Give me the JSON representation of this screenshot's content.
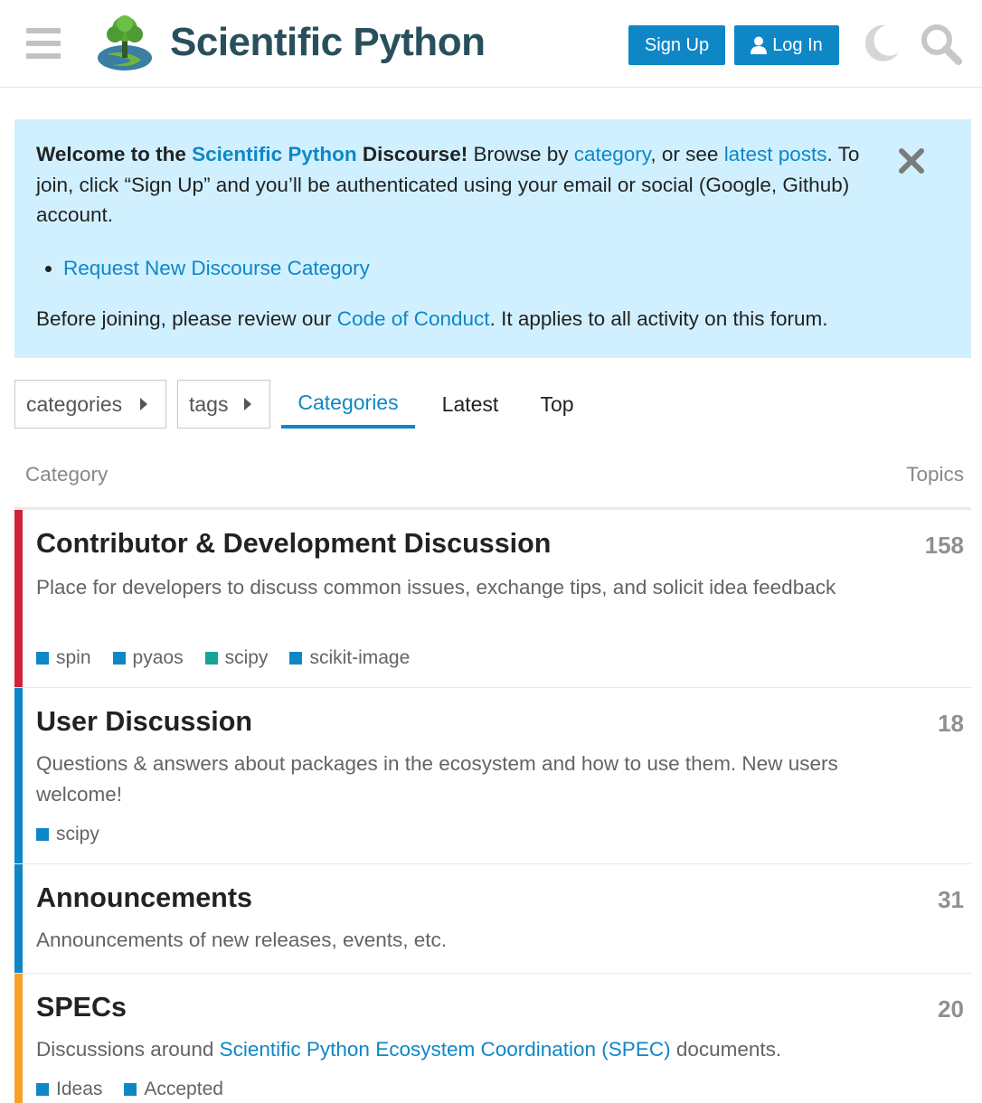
{
  "header": {
    "site_name": "Scientific Python",
    "signup_label": "Sign Up",
    "login_label": "Log In"
  },
  "banner": {
    "welcome_bold_1": "Welcome to the ",
    "welcome_link": "Scientific Python",
    "welcome_bold_2": " Discourse!",
    "text_1": " Browse by ",
    "category_link": "category",
    "text_2": ", or see ",
    "latest_link": "latest posts",
    "text_3": ". To join, click “Sign Up” and you’ll be authenticated using your email or social (Google, Github) account.",
    "list_item": "Request New Discourse Category",
    "coc_text_1": "Before joining, please review our ",
    "coc_link": "Code of Conduct",
    "coc_text_2": ". It applies to all activity on this forum."
  },
  "nav": {
    "categories_dropdown": "categories",
    "tags_dropdown": "tags",
    "tabs": [
      "Categories",
      "Latest",
      "Top"
    ]
  },
  "table": {
    "col_category": "Category",
    "col_topics": "Topics"
  },
  "categories": [
    {
      "title": "Contributor & Development Discussion",
      "description": "Place for developers to discuss common issues, exchange tips, and solicit idea feedback",
      "topics": "158",
      "color": "#d0223a",
      "subcategories": [
        {
          "name": "spin",
          "color": "#0f87c7"
        },
        {
          "name": "pyaos",
          "color": "#0f87c7"
        },
        {
          "name": "scipy",
          "color": "#16a399"
        },
        {
          "name": "scikit-image",
          "color": "#0f87c7"
        }
      ]
    },
    {
      "title": "User Discussion",
      "description": "Questions & answers about packages in the ecosystem and how to use them. New users welcome!",
      "topics": "18",
      "color": "#0f87c7",
      "subcategories": [
        {
          "name": "scipy",
          "color": "#0f87c7"
        }
      ]
    },
    {
      "title": "Announcements",
      "description": "Announcements of new releases, events, etc.",
      "topics": "31",
      "color": "#0f87c7",
      "subcategories": []
    },
    {
      "title": "SPECs",
      "description_1": "Discussions around ",
      "description_link": "Scientific Python Ecosystem Coordination (SPEC)",
      "description_2": " documents.",
      "topics": "20",
      "color": "#f7a128",
      "subcategories": [
        {
          "name": "Ideas",
          "color": "#0f87c7"
        },
        {
          "name": "Accepted",
          "color": "#0f87c7"
        }
      ]
    }
  ]
}
